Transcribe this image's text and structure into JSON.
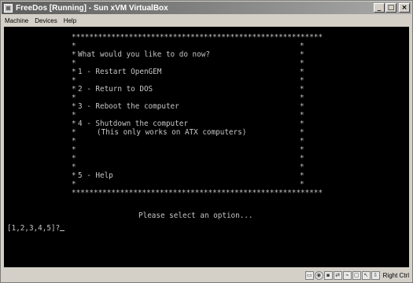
{
  "window": {
    "title": "FreeDos [Running] - Sun xVM VirtualBox",
    "caption_buttons": {
      "minimize": "_",
      "maximize": "□",
      "close": "×"
    }
  },
  "menubar": {
    "items": [
      {
        "label": "Machine"
      },
      {
        "label": "Devices"
      },
      {
        "label": "Help"
      }
    ]
  },
  "dos_screen": {
    "border_top": "*********************************************************",
    "side_left": "*",
    "side_right": "*",
    "question": "What would you like to do now?",
    "option1": "1 - Restart OpenGEM",
    "option2": "2 - Return to DOS",
    "option3": "3 - Reboot the computer",
    "option4": "4 - Shutdown the computer",
    "option4_note": "(This only works on ATX computers)",
    "option5": "5 - Help",
    "border_bottom": "*********************************************************",
    "prompt_message": "Please select an option...",
    "input_prompt": "[1,2,3,4,5]?"
  },
  "statusbar": {
    "icons": [
      "hard-disk-icon",
      "cd-icon",
      "floppy-icon",
      "network-icon",
      "usb-icon",
      "shared-folder-icon",
      "mouse-integration-icon",
      "host-key-icon"
    ],
    "host_key_label": "Right Ctrl"
  }
}
